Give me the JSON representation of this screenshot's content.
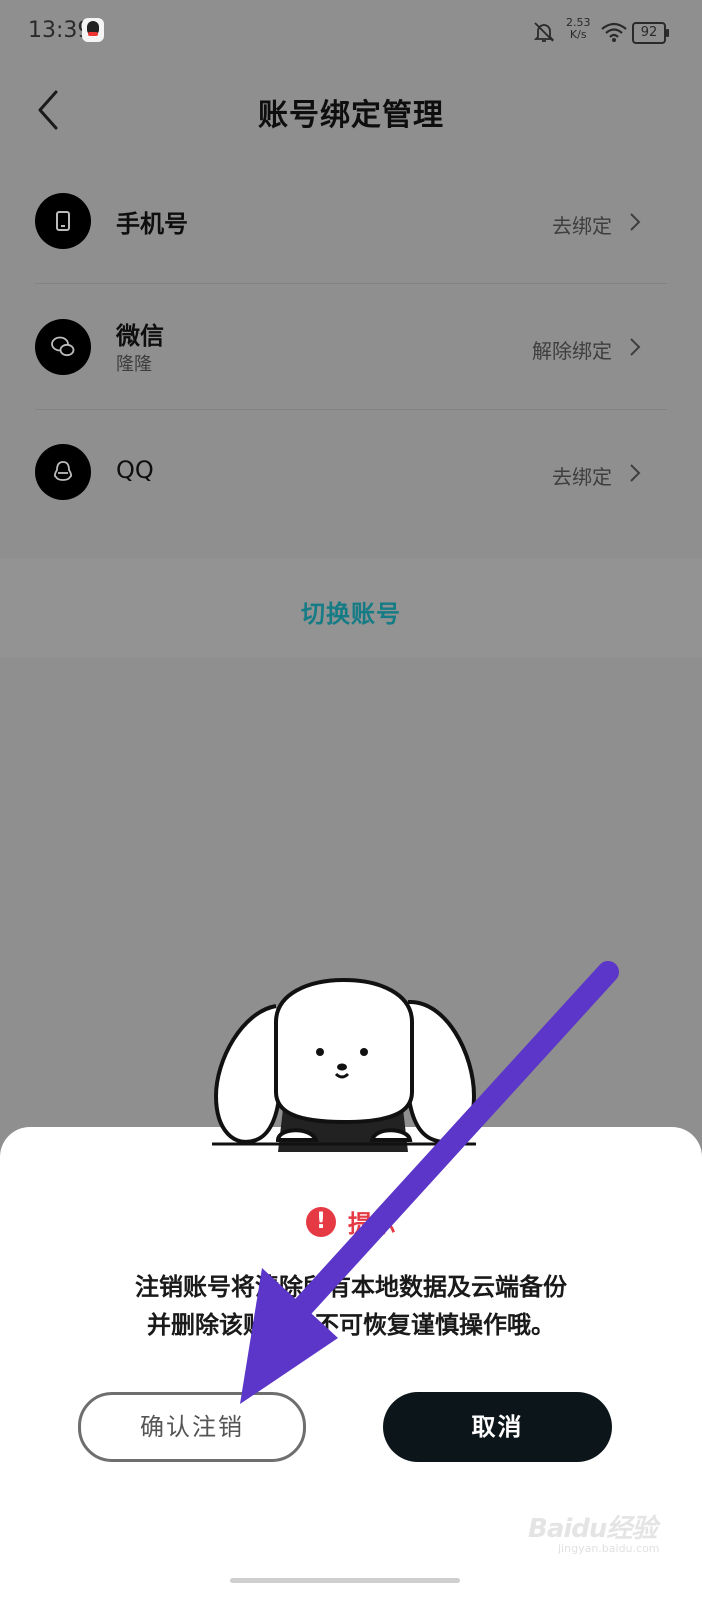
{
  "status_bar": {
    "time": "13:39",
    "speed_value": "2.53",
    "speed_unit": "K/s",
    "battery": "92"
  },
  "header": {
    "title": "账号绑定管理"
  },
  "accounts": [
    {
      "name": "手机号",
      "sub": "",
      "action": "去绑定",
      "icon": "phone-icon"
    },
    {
      "name": "微信",
      "sub": "隆隆",
      "action": "解除绑定",
      "icon": "wechat-icon"
    },
    {
      "name": "QQ",
      "sub": "",
      "action": "去绑定",
      "icon": "qq-icon"
    }
  ],
  "switch_account": "切换账号",
  "dialog": {
    "tip_title": "提示",
    "message_line1": "注销账号将清除所有本地数据及云端备份",
    "message_line2": "并删除该账号，不可恢复谨慎操作哦。",
    "confirm_label": "确认注销",
    "cancel_label": "取消"
  },
  "watermark": {
    "logo": "Baidu经验",
    "url": "jingyan.baidu.com"
  },
  "colors": {
    "accent_teal": "#157c86",
    "warning_red": "#e53a44",
    "button_dark": "#0c1519",
    "annotation_arrow": "#5b36c9"
  }
}
